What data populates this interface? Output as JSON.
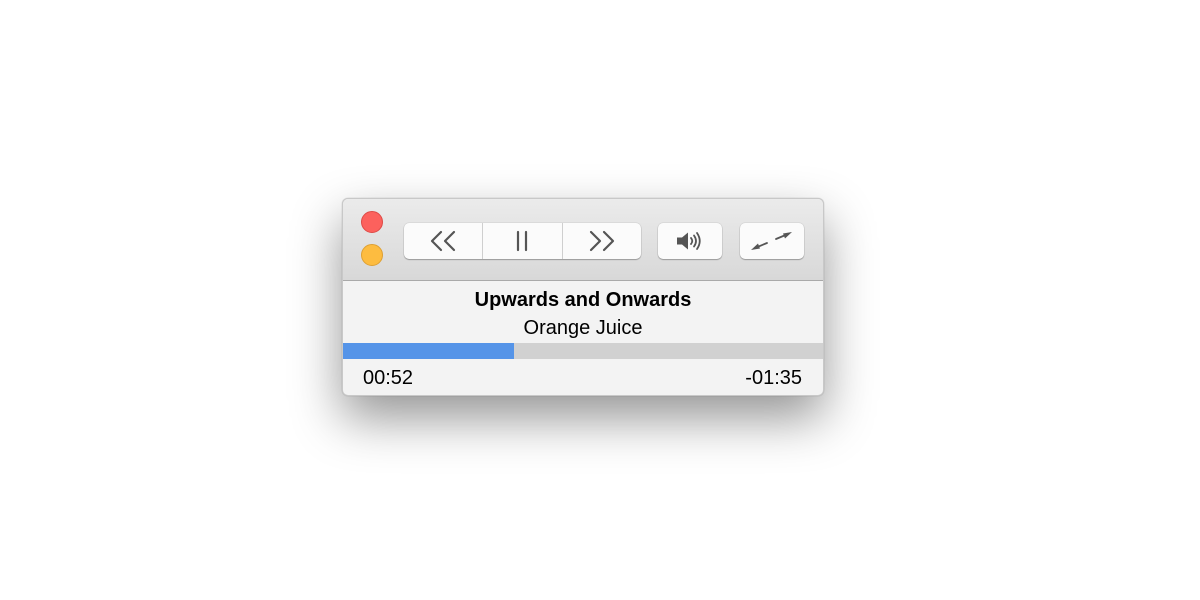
{
  "window": {
    "close_icon": "close-traffic-light",
    "minimize_icon": "minimize-traffic-light"
  },
  "controls": {
    "rewind_icon": "double-chevron-left",
    "pause_icon": "pause",
    "fast_forward_icon": "double-chevron-right",
    "volume_icon": "speaker-with-sound-waves",
    "resize_icon": "diagonal-double-arrows"
  },
  "track": {
    "title": "Upwards and Onwards",
    "artist": "Orange Juice"
  },
  "playback": {
    "elapsed": "00:52",
    "remaining": "-01:35",
    "progress_fraction": 0.356
  },
  "colors": {
    "close": "#fc615d",
    "minimize": "#fdbc40",
    "progress_fill": "#5594e8",
    "progress_track": "#d1d1d1",
    "icon": "#555555"
  }
}
